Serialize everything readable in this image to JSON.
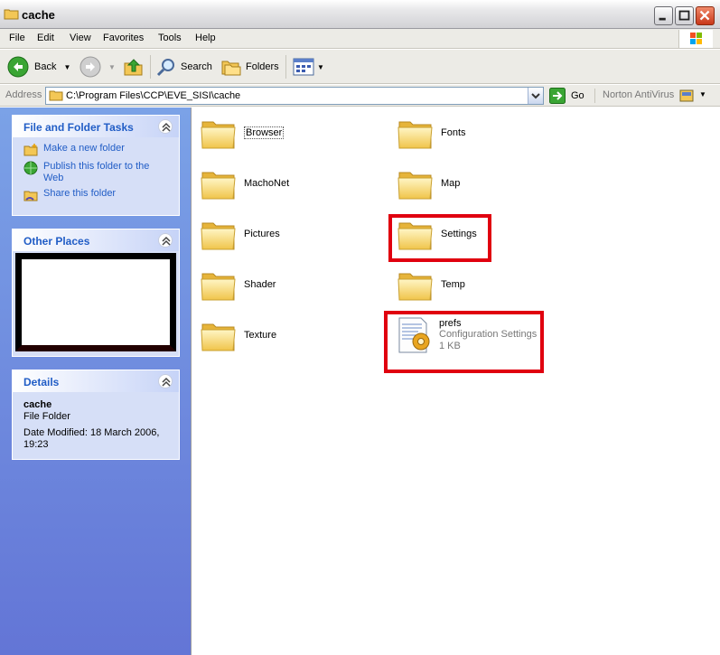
{
  "window": {
    "title": "cache"
  },
  "menu": [
    "File",
    "Edit",
    "View",
    "Favorites",
    "Tools",
    "Help"
  ],
  "toolbar": {
    "back": "Back",
    "search": "Search",
    "folders": "Folders"
  },
  "address": {
    "label": "Address",
    "path": "C:\\Program Files\\CCP\\EVE_SISI\\cache",
    "go": "Go",
    "norton": "Norton AntiVirus"
  },
  "left": {
    "tasks_title": "File and Folder Tasks",
    "tasks": [
      "Make a new folder",
      "Publish this folder to the Web",
      "Share this folder"
    ],
    "other_title": "Other Places",
    "details_title": "Details",
    "details": {
      "name": "cache",
      "type": "File Folder",
      "modified": "Date Modified: 18 March 2006, 19:23"
    }
  },
  "items": [
    {
      "name": "Browser"
    },
    {
      "name": "Fonts"
    },
    {
      "name": "MachoNet"
    },
    {
      "name": "Map"
    },
    {
      "name": "Pictures"
    },
    {
      "name": "Settings"
    },
    {
      "name": "Shader"
    },
    {
      "name": "Temp"
    },
    {
      "name": "Texture"
    }
  ],
  "file": {
    "name": "prefs",
    "type": "Configuration Settings",
    "size": "1 KB"
  },
  "colors": {
    "highlight": "#e0000f",
    "link": "#215dc6"
  }
}
